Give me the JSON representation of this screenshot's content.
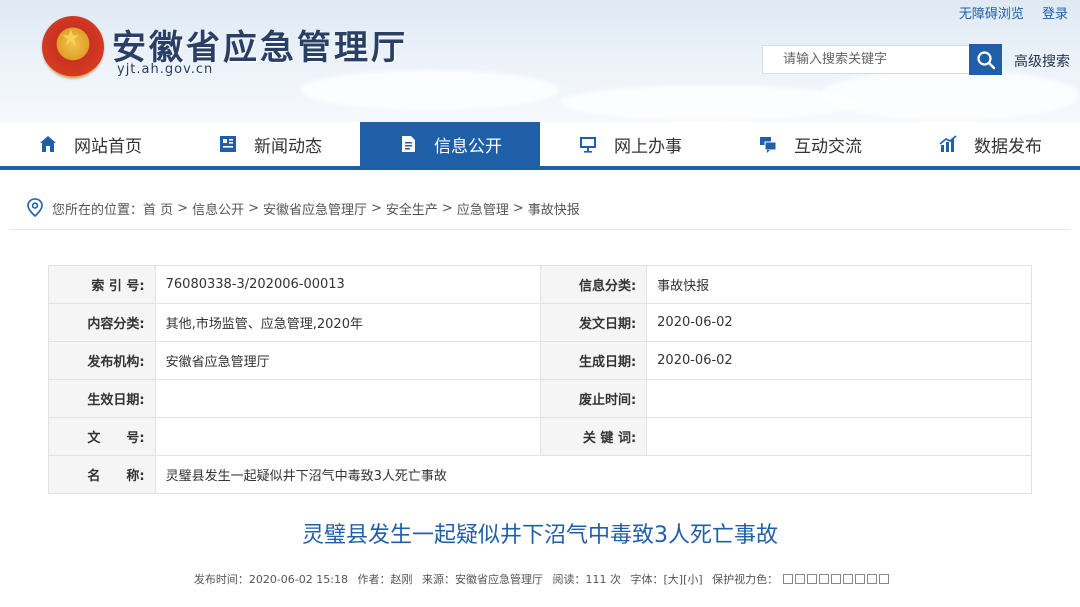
{
  "site": {
    "name": "安徽省应急管理厅",
    "domain": "yjt.ah.gov.cn"
  },
  "top_links": {
    "accessible": "无障碍浏览",
    "login": "登录"
  },
  "search": {
    "placeholder": "请输入搜索关键字",
    "advanced": "高级搜索"
  },
  "nav": [
    {
      "label": "网站首页",
      "icon": "home-icon"
    },
    {
      "label": "新闻动态",
      "icon": "news-icon"
    },
    {
      "label": "信息公开",
      "icon": "document-icon",
      "active": true
    },
    {
      "label": "网上办事",
      "icon": "monitor-icon"
    },
    {
      "label": "互动交流",
      "icon": "chat-icon"
    },
    {
      "label": "数据发布",
      "icon": "chart-icon"
    }
  ],
  "breadcrumb": {
    "prefix": "您所在的位置：",
    "items": [
      "首 页",
      "信息公开",
      "安徽省应急管理厅",
      "安全生产",
      "应急管理",
      "事故快报"
    ],
    "separator": ">"
  },
  "meta": {
    "rows": [
      {
        "l1": "索 引 号:",
        "v1": "76080338-3/202006-00013",
        "l2": "信息分类:",
        "v2": "事故快报"
      },
      {
        "l1": "内容分类:",
        "v1": "其他,市场监管、应急管理,2020年",
        "l2": "发文日期:",
        "v2": "2020-06-02"
      },
      {
        "l1": "发布机构:",
        "v1": "安徽省应急管理厅",
        "l2": "生成日期:",
        "v2": "2020-06-02"
      },
      {
        "l1": "生效日期:",
        "v1": "",
        "l2": "废止时间:",
        "v2": ""
      },
      {
        "l1": "文　　号:",
        "v1": "",
        "l2": "关 键 词:",
        "v2": ""
      }
    ],
    "name_label": "名　　称:",
    "name_value": "灵璧县发生一起疑似井下沼气中毒致3人死亡事故"
  },
  "article": {
    "title": "灵璧县发生一起疑似井下沼气中毒致3人死亡事故",
    "publish_time": "发布时间：2020-06-02 15:18",
    "author": "作者：赵刚",
    "source": "来源：安徽省应急管理厅",
    "views": "阅读：111 次",
    "font_label": "字体：",
    "font_large": "[大]",
    "font_small": "[小]",
    "eye_protect": "保护视力色："
  },
  "colors": {
    "brand": "#1f5fa8",
    "title": "#1f5fa8"
  }
}
